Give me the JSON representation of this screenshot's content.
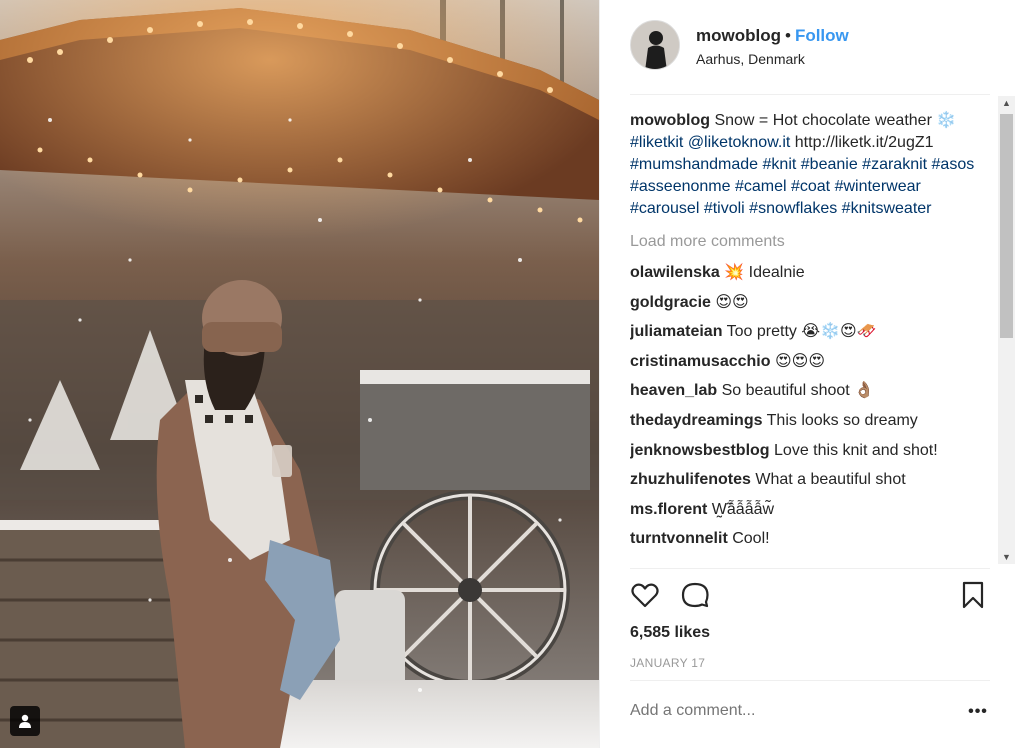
{
  "post": {
    "username": "mowoblog",
    "separator": "•",
    "follow_label": "Follow",
    "location": "Aarhus, Denmark"
  },
  "caption": {
    "username": "mowoblog",
    "text": "Snow = Hot chocolate weather",
    "emoji": "❄️",
    "tag_liketkit": "#liketkit",
    "mention": "@liketoknow.it",
    "url": "http://liketk.it/2ugZ1",
    "tags_line1": "#mumshandmade",
    "tags_line2": "#knit #beanie #zaraknit #asos",
    "tags_line3": "#asseenonme #camel #coat #winterwear",
    "tags_line4": "#carousel #tivoli #snowflakes #knitsweater"
  },
  "load_more": "Load more comments",
  "comments": [
    {
      "user": "olawilenska",
      "text": "💥 Idealnie"
    },
    {
      "user": "goldgracie",
      "text": "😍😍"
    },
    {
      "user": "juliamateian",
      "text": "Too pretty 😭❄️😍🛷"
    },
    {
      "user": "cristinamusacchio",
      "text": "😍😍😍"
    },
    {
      "user": "heaven_lab",
      "text": "So beautiful shoot 👌🏽"
    },
    {
      "user": "thedaydreamings",
      "text": "This looks so dreamy"
    },
    {
      "user": "jenknowsbestblog",
      "text": "Love this knit and shot!"
    },
    {
      "user": "zhuzhulifenotes",
      "text": "What a beautiful shot"
    },
    {
      "user": "ms.florent",
      "text": "W̰̃ẫẫẫẫw̃"
    },
    {
      "user": "turntvonnelit",
      "text": "Cool!"
    }
  ],
  "actions": {
    "like_icon": "heart-icon",
    "comment_icon": "comment-icon",
    "save_icon": "bookmark-icon"
  },
  "likes": "6,585 likes",
  "date": "JANUARY 17",
  "add_comment_placeholder": "Add a comment...",
  "more_label": "•••",
  "colors": {
    "link": "#3897f0",
    "hashtag": "#003569",
    "muted": "#999999",
    "text": "#262626"
  }
}
